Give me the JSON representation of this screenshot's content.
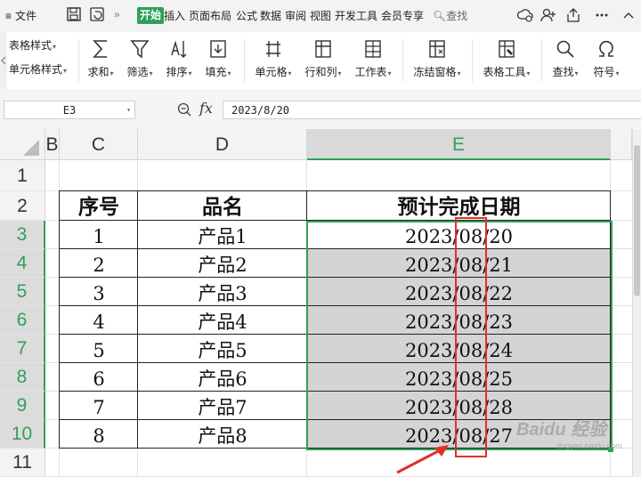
{
  "menubar": {
    "file": "文件",
    "more": "»",
    "tabs": [
      "开始",
      "插入",
      "页面布局",
      "公式",
      "数据",
      "审阅",
      "视图",
      "开发工具",
      "会员专享"
    ],
    "search": "查找"
  },
  "toolbar": {
    "table_style": "表格样式",
    "cell_style": "单元格样式",
    "sum": "求和",
    "filter": "筛选",
    "sort": "排序",
    "fill": "填充",
    "cell": "单元格",
    "rowcol": "行和列",
    "sheet": "工作表",
    "freeze": "冻结窗格",
    "table_tools": "表格工具",
    "find": "查找",
    "symbol": "符号"
  },
  "formula_bar": {
    "name_box": "E3",
    "fx": "fx",
    "value": "2023/8/20"
  },
  "columns": [
    "B",
    "C",
    "D",
    "E"
  ],
  "rows": [
    "1",
    "2",
    "3",
    "4",
    "5",
    "6",
    "7",
    "8",
    "9",
    "10",
    "11"
  ],
  "table": {
    "headers": [
      "序号",
      "品名",
      "预计完成日期"
    ],
    "rows": [
      [
        "1",
        "产品1",
        "2023/08/20"
      ],
      [
        "2",
        "产品2",
        "2023/08/21"
      ],
      [
        "3",
        "产品3",
        "2023/08/22"
      ],
      [
        "4",
        "产品4",
        "2023/08/23"
      ],
      [
        "5",
        "产品5",
        "2023/08/24"
      ],
      [
        "6",
        "产品6",
        "2023/08/25"
      ],
      [
        "7",
        "产品7",
        "2023/08/28"
      ],
      [
        "8",
        "产品8",
        "2023/08/27"
      ]
    ]
  },
  "watermark": {
    "brand": "Baidu 经验",
    "sub": "jingyan.baidu.com"
  },
  "colors": {
    "accent": "#2f9f5c",
    "annotation": "#e0302a",
    "selection_fill": "#d4d4d4"
  }
}
